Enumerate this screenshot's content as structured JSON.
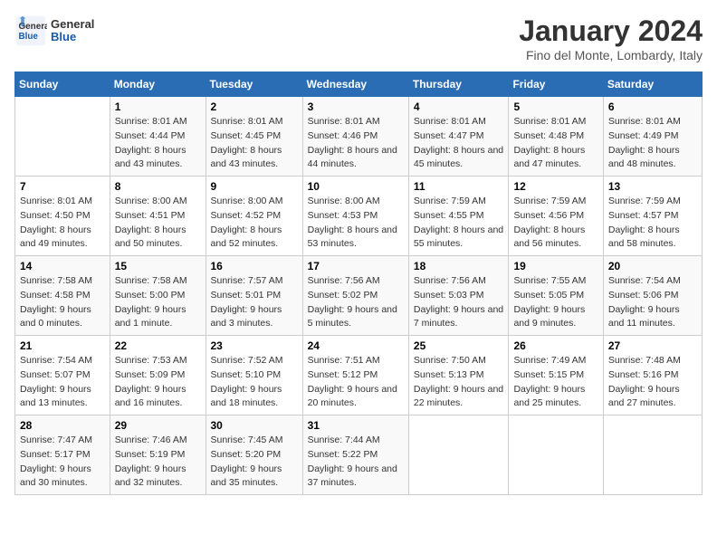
{
  "header": {
    "logo_line1": "General",
    "logo_line2": "Blue",
    "month": "January 2024",
    "location": "Fino del Monte, Lombardy, Italy"
  },
  "columns": [
    "Sunday",
    "Monday",
    "Tuesday",
    "Wednesday",
    "Thursday",
    "Friday",
    "Saturday"
  ],
  "weeks": [
    [
      {
        "day": "",
        "sunrise": "",
        "sunset": "",
        "daylight": ""
      },
      {
        "day": "1",
        "sunrise": "Sunrise: 8:01 AM",
        "sunset": "Sunset: 4:44 PM",
        "daylight": "Daylight: 8 hours and 43 minutes."
      },
      {
        "day": "2",
        "sunrise": "Sunrise: 8:01 AM",
        "sunset": "Sunset: 4:45 PM",
        "daylight": "Daylight: 8 hours and 43 minutes."
      },
      {
        "day": "3",
        "sunrise": "Sunrise: 8:01 AM",
        "sunset": "Sunset: 4:46 PM",
        "daylight": "Daylight: 8 hours and 44 minutes."
      },
      {
        "day": "4",
        "sunrise": "Sunrise: 8:01 AM",
        "sunset": "Sunset: 4:47 PM",
        "daylight": "Daylight: 8 hours and 45 minutes."
      },
      {
        "day": "5",
        "sunrise": "Sunrise: 8:01 AM",
        "sunset": "Sunset: 4:48 PM",
        "daylight": "Daylight: 8 hours and 47 minutes."
      },
      {
        "day": "6",
        "sunrise": "Sunrise: 8:01 AM",
        "sunset": "Sunset: 4:49 PM",
        "daylight": "Daylight: 8 hours and 48 minutes."
      }
    ],
    [
      {
        "day": "7",
        "sunrise": "Sunrise: 8:01 AM",
        "sunset": "Sunset: 4:50 PM",
        "daylight": "Daylight: 8 hours and 49 minutes."
      },
      {
        "day": "8",
        "sunrise": "Sunrise: 8:00 AM",
        "sunset": "Sunset: 4:51 PM",
        "daylight": "Daylight: 8 hours and 50 minutes."
      },
      {
        "day": "9",
        "sunrise": "Sunrise: 8:00 AM",
        "sunset": "Sunset: 4:52 PM",
        "daylight": "Daylight: 8 hours and 52 minutes."
      },
      {
        "day": "10",
        "sunrise": "Sunrise: 8:00 AM",
        "sunset": "Sunset: 4:53 PM",
        "daylight": "Daylight: 8 hours and 53 minutes."
      },
      {
        "day": "11",
        "sunrise": "Sunrise: 7:59 AM",
        "sunset": "Sunset: 4:55 PM",
        "daylight": "Daylight: 8 hours and 55 minutes."
      },
      {
        "day": "12",
        "sunrise": "Sunrise: 7:59 AM",
        "sunset": "Sunset: 4:56 PM",
        "daylight": "Daylight: 8 hours and 56 minutes."
      },
      {
        "day": "13",
        "sunrise": "Sunrise: 7:59 AM",
        "sunset": "Sunset: 4:57 PM",
        "daylight": "Daylight: 8 hours and 58 minutes."
      }
    ],
    [
      {
        "day": "14",
        "sunrise": "Sunrise: 7:58 AM",
        "sunset": "Sunset: 4:58 PM",
        "daylight": "Daylight: 9 hours and 0 minutes."
      },
      {
        "day": "15",
        "sunrise": "Sunrise: 7:58 AM",
        "sunset": "Sunset: 5:00 PM",
        "daylight": "Daylight: 9 hours and 1 minute."
      },
      {
        "day": "16",
        "sunrise": "Sunrise: 7:57 AM",
        "sunset": "Sunset: 5:01 PM",
        "daylight": "Daylight: 9 hours and 3 minutes."
      },
      {
        "day": "17",
        "sunrise": "Sunrise: 7:56 AM",
        "sunset": "Sunset: 5:02 PM",
        "daylight": "Daylight: 9 hours and 5 minutes."
      },
      {
        "day": "18",
        "sunrise": "Sunrise: 7:56 AM",
        "sunset": "Sunset: 5:03 PM",
        "daylight": "Daylight: 9 hours and 7 minutes."
      },
      {
        "day": "19",
        "sunrise": "Sunrise: 7:55 AM",
        "sunset": "Sunset: 5:05 PM",
        "daylight": "Daylight: 9 hours and 9 minutes."
      },
      {
        "day": "20",
        "sunrise": "Sunrise: 7:54 AM",
        "sunset": "Sunset: 5:06 PM",
        "daylight": "Daylight: 9 hours and 11 minutes."
      }
    ],
    [
      {
        "day": "21",
        "sunrise": "Sunrise: 7:54 AM",
        "sunset": "Sunset: 5:07 PM",
        "daylight": "Daylight: 9 hours and 13 minutes."
      },
      {
        "day": "22",
        "sunrise": "Sunrise: 7:53 AM",
        "sunset": "Sunset: 5:09 PM",
        "daylight": "Daylight: 9 hours and 16 minutes."
      },
      {
        "day": "23",
        "sunrise": "Sunrise: 7:52 AM",
        "sunset": "Sunset: 5:10 PM",
        "daylight": "Daylight: 9 hours and 18 minutes."
      },
      {
        "day": "24",
        "sunrise": "Sunrise: 7:51 AM",
        "sunset": "Sunset: 5:12 PM",
        "daylight": "Daylight: 9 hours and 20 minutes."
      },
      {
        "day": "25",
        "sunrise": "Sunrise: 7:50 AM",
        "sunset": "Sunset: 5:13 PM",
        "daylight": "Daylight: 9 hours and 22 minutes."
      },
      {
        "day": "26",
        "sunrise": "Sunrise: 7:49 AM",
        "sunset": "Sunset: 5:15 PM",
        "daylight": "Daylight: 9 hours and 25 minutes."
      },
      {
        "day": "27",
        "sunrise": "Sunrise: 7:48 AM",
        "sunset": "Sunset: 5:16 PM",
        "daylight": "Daylight: 9 hours and 27 minutes."
      }
    ],
    [
      {
        "day": "28",
        "sunrise": "Sunrise: 7:47 AM",
        "sunset": "Sunset: 5:17 PM",
        "daylight": "Daylight: 9 hours and 30 minutes."
      },
      {
        "day": "29",
        "sunrise": "Sunrise: 7:46 AM",
        "sunset": "Sunset: 5:19 PM",
        "daylight": "Daylight: 9 hours and 32 minutes."
      },
      {
        "day": "30",
        "sunrise": "Sunrise: 7:45 AM",
        "sunset": "Sunset: 5:20 PM",
        "daylight": "Daylight: 9 hours and 35 minutes."
      },
      {
        "day": "31",
        "sunrise": "Sunrise: 7:44 AM",
        "sunset": "Sunset: 5:22 PM",
        "daylight": "Daylight: 9 hours and 37 minutes."
      },
      {
        "day": "",
        "sunrise": "",
        "sunset": "",
        "daylight": ""
      },
      {
        "day": "",
        "sunrise": "",
        "sunset": "",
        "daylight": ""
      },
      {
        "day": "",
        "sunrise": "",
        "sunset": "",
        "daylight": ""
      }
    ]
  ]
}
